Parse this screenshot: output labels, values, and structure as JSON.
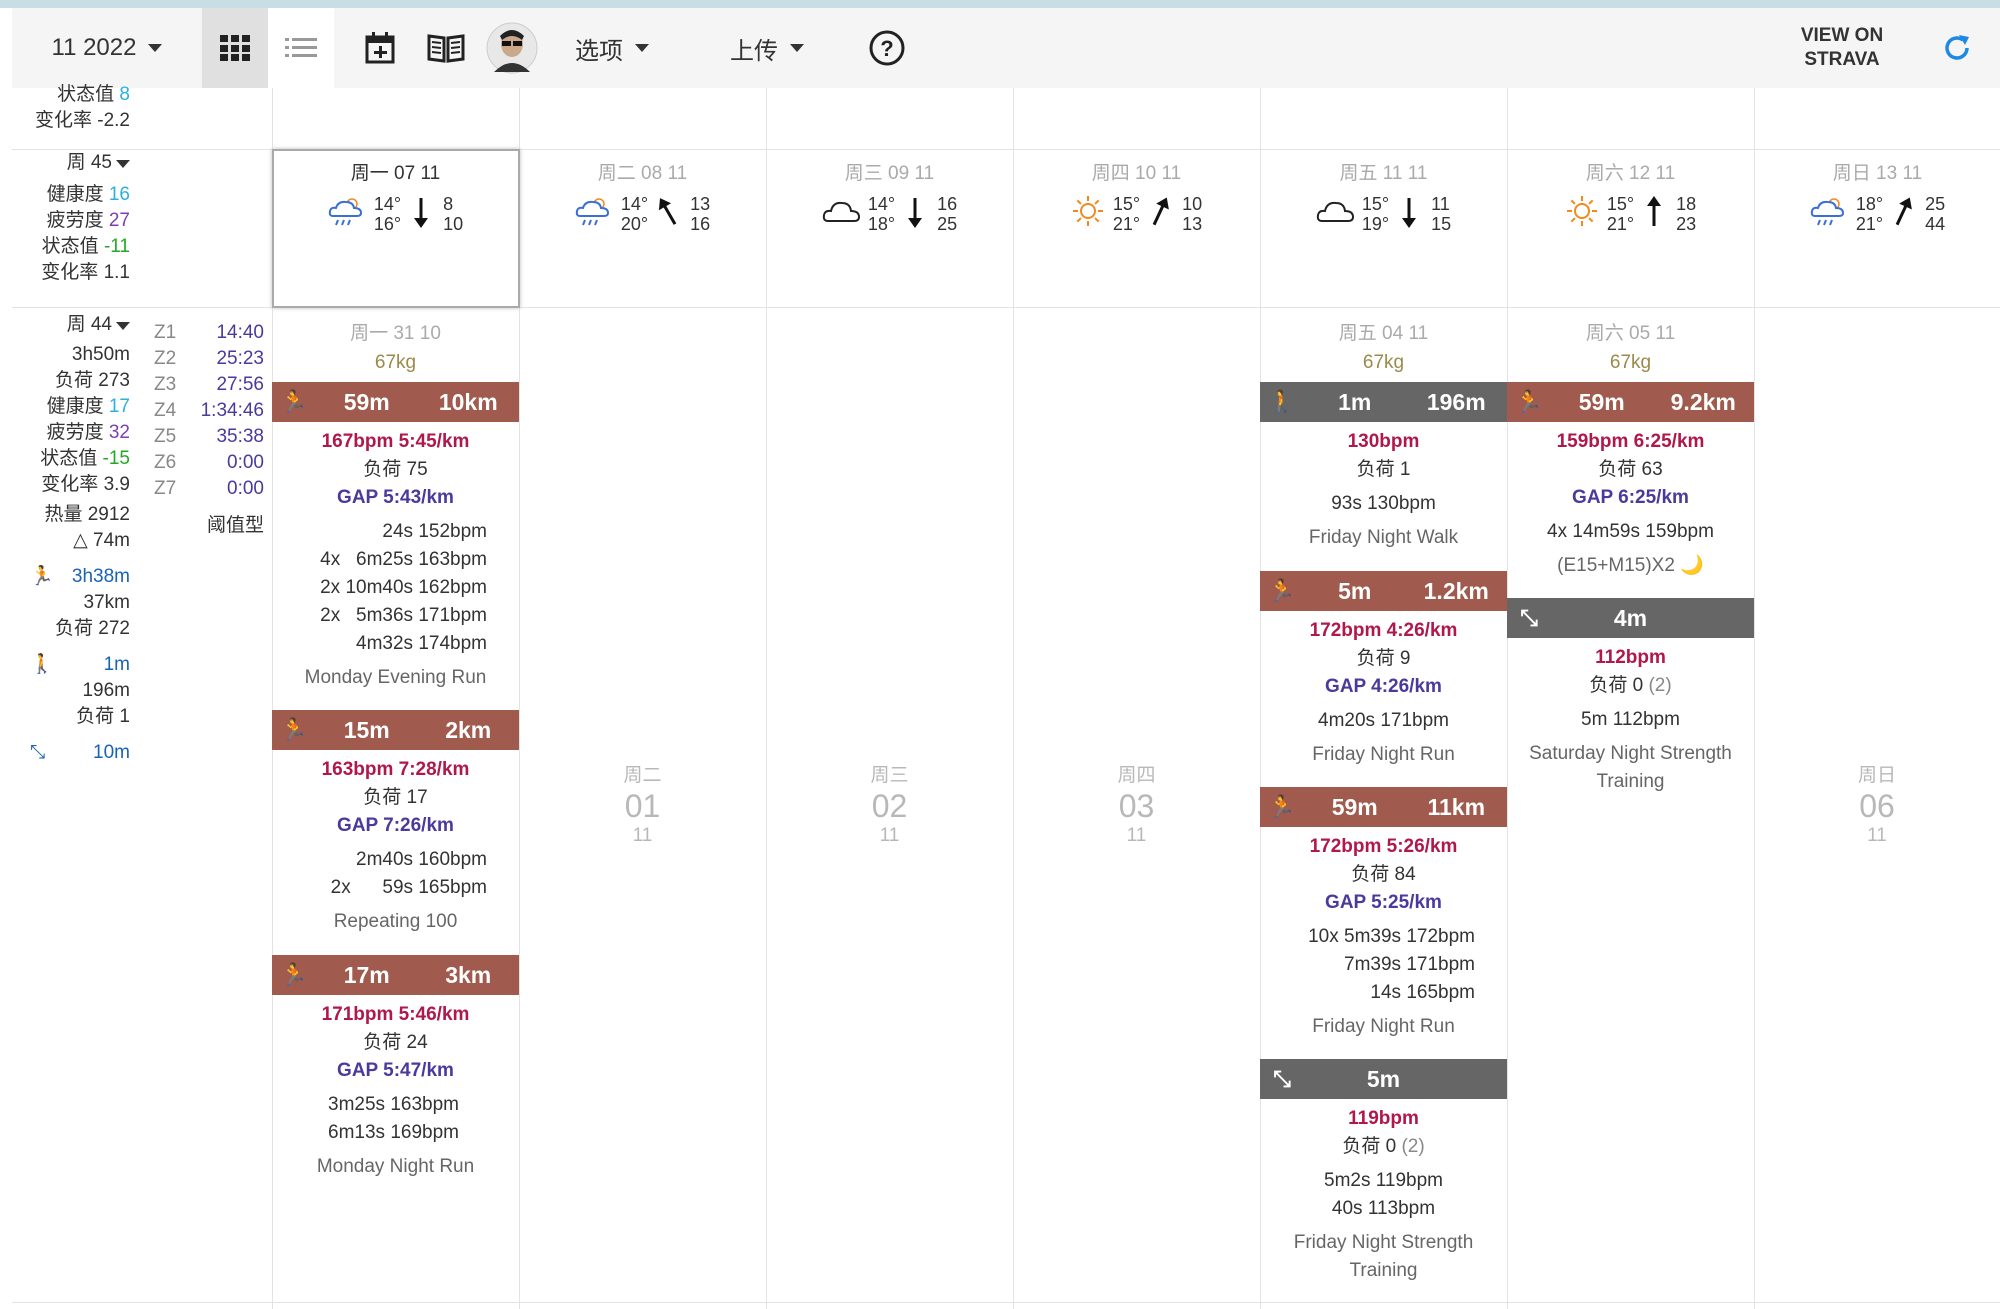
{
  "toolbar": {
    "month": "11 2022",
    "options": "选项",
    "upload": "上传",
    "strava": [
      "VIEW ON",
      "STRAVA"
    ]
  },
  "prev_week": {
    "status": "状态值",
    "status_val": "8",
    "rate": "变化率 -2.2"
  },
  "week45": {
    "label": "周 45",
    "fitness": "健康度",
    "fitness_val": "16",
    "fatigue": "疲劳度",
    "fatigue_val": "27",
    "form": "状态值",
    "form_val": "-11",
    "rate": "变化率 1.1",
    "days": [
      {
        "name": "周一 07 11",
        "t1": "14°",
        "t2": "16°",
        "w1": "8",
        "w2": "10"
      },
      {
        "name": "周二 08 11",
        "t1": "14°",
        "t2": "20°",
        "w1": "13",
        "w2": "16"
      },
      {
        "name": "周三 09 11",
        "t1": "14°",
        "t2": "18°",
        "w1": "16",
        "w2": "25"
      },
      {
        "name": "周四 10 11",
        "t1": "15°",
        "t2": "21°",
        "w1": "10",
        "w2": "13"
      },
      {
        "name": "周五 11 11",
        "t1": "15°",
        "t2": "19°",
        "w1": "11",
        "w2": "15"
      },
      {
        "name": "周六 12 11",
        "t1": "15°",
        "t2": "21°",
        "w1": "18",
        "w2": "23"
      },
      {
        "name": "周日 13 11",
        "t1": "18°",
        "t2": "21°",
        "w1": "25",
        "w2": "44"
      }
    ]
  },
  "week44": {
    "label": "周 44",
    "duration": "3h50m",
    "load": "负荷 273",
    "fitness": "健康度",
    "fitness_val": "17",
    "fatigue": "疲劳度",
    "fatigue_val": "32",
    "form": "状态值",
    "form_val": "-15",
    "rate": "变化率 3.9",
    "calories": "热量 2912",
    "elev": "△ 74m",
    "run_time": "3h38m",
    "run_dist": "37km",
    "run_load": "负荷 272",
    "walk_time": "1m",
    "walk_dist": "196m",
    "walk_load": "负荷 1",
    "str_time": "10m",
    "threshold": "阈值型",
    "zones": [
      {
        "z": "Z1",
        "t": "14:40"
      },
      {
        "z": "Z2",
        "t": "25:23"
      },
      {
        "z": "Z3",
        "t": "27:56"
      },
      {
        "z": "Z4",
        "t": "1:34:46"
      },
      {
        "z": "Z5",
        "t": "35:38"
      },
      {
        "z": "Z6",
        "t": "0:00"
      },
      {
        "z": "Z7",
        "t": "0:00"
      }
    ]
  },
  "mon": {
    "hdr": "周一 31 10",
    "weight": "67kg",
    "a1": {
      "time": "59m",
      "dist": "10km",
      "hr": "167bpm 5:45/km",
      "load": "负荷 75",
      "gap": "GAP 5:43/km",
      "l1": "24s 152bpm",
      "l2": "4x   6m25s 163bpm",
      "l3": "2x 10m40s 162bpm",
      "l4": "2x   5m36s 171bpm",
      "l5": "4m32s 174bpm",
      "title": "Monday Evening Run"
    },
    "a2": {
      "time": "15m",
      "dist": "2km",
      "hr": "163bpm 7:28/km",
      "load": "负荷 17",
      "gap": "GAP 7:26/km",
      "l1": "2m40s 160bpm",
      "l2": "2x      59s 165bpm",
      "title": "Repeating 100"
    },
    "a3": {
      "time": "17m",
      "dist": "3km",
      "hr": "171bpm 5:46/km",
      "load": "负荷 24",
      "gap": "GAP 5:47/km",
      "l1": "3m25s 163bpm",
      "l2": "6m13s 169bpm",
      "title": "Monday Night Run"
    }
  },
  "empty_days": [
    {
      "n": "周二",
      "d": "01",
      "m": "11"
    },
    {
      "n": "周三",
      "d": "02",
      "m": "11"
    },
    {
      "n": "周四",
      "d": "03",
      "m": "11"
    },
    {
      "n": "周日",
      "d": "06",
      "m": "11"
    }
  ],
  "fri": {
    "hdr": "周五 04 11",
    "weight": "67kg",
    "a1": {
      "time": "1m",
      "dist": "196m",
      "hr": "130bpm",
      "load": "负荷 1",
      "l1": "93s 130bpm",
      "title": "Friday Night Walk"
    },
    "a2": {
      "time": "5m",
      "dist": "1.2km",
      "hr": "172bpm 4:26/km",
      "load": "负荷 9",
      "gap": "GAP 4:26/km",
      "l1": "4m20s 171bpm",
      "title": "Friday Night Run"
    },
    "a3": {
      "time": "59m",
      "dist": "11km",
      "hr": "172bpm 5:26/km",
      "load": "负荷 84",
      "gap": "GAP 5:25/km",
      "l1": "10x 5m39s 172bpm",
      "l2": "7m39s 171bpm",
      "l3": "14s 165bpm",
      "title": "Friday Night Run"
    },
    "a4": {
      "time": "5m",
      "hr": "119bpm",
      "load": "负荷 0",
      "load2": "(2)",
      "l1": "5m2s 119bpm",
      "l2": "40s 113bpm",
      "title1": "Friday Night Strength",
      "title2": "Training"
    }
  },
  "sat": {
    "hdr": "周六 05 11",
    "weight": "67kg",
    "a1": {
      "time": "59m",
      "dist": "9.2km",
      "hr": "159bpm 6:25/km",
      "load": "负荷 63",
      "gap": "GAP 6:25/km",
      "l1": "4x 14m59s 159bpm",
      "l2": "(E15+M15)X2 🌙"
    },
    "a2": {
      "time": "4m",
      "hr": "112bpm",
      "load": "负荷 0",
      "load2": "(2)",
      "l1": "5m 112bpm",
      "title1": "Saturday Night Strength",
      "title2": "Training"
    }
  },
  "colors": {
    "run": "#a05a4e",
    "gray": "#666666",
    "hr": "#b0184a",
    "gap": "#4b3a9c"
  }
}
